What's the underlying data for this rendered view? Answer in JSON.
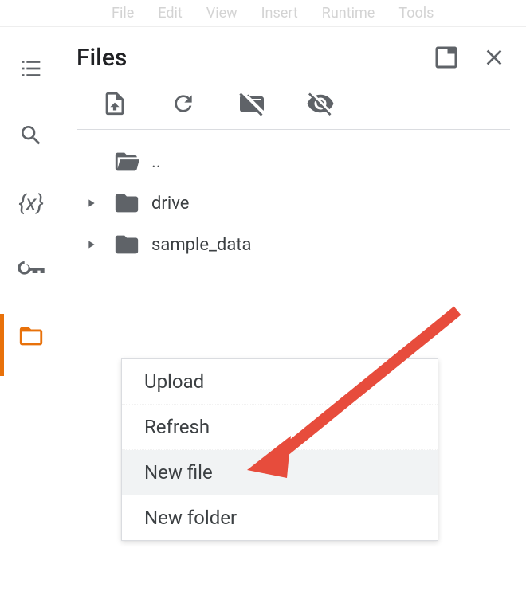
{
  "menubar": {
    "items": [
      "File",
      "Edit",
      "View",
      "Insert",
      "Runtime",
      "Tools"
    ]
  },
  "panel": {
    "title": "Files"
  },
  "tree": {
    "parent": "..",
    "items": [
      {
        "label": "drive"
      },
      {
        "label": "sample_data"
      }
    ]
  },
  "context_menu": {
    "items": [
      {
        "label": "Upload"
      },
      {
        "label": "Refresh"
      },
      {
        "label": "New file",
        "highlighted": true
      },
      {
        "label": "New folder"
      }
    ]
  }
}
